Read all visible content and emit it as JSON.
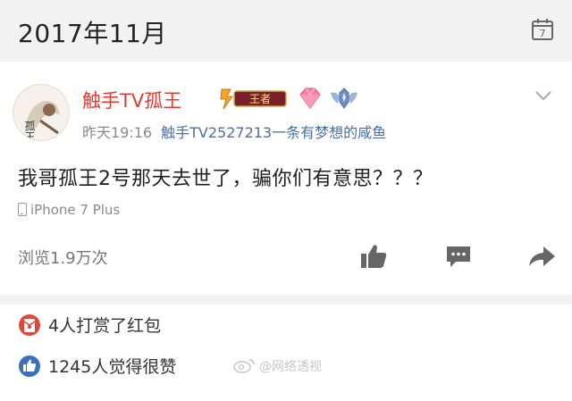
{
  "header": {
    "month": "2017年11月",
    "calendar_icon": "calendar-icon",
    "calendar_day": "7"
  },
  "post": {
    "author": "触手TV孤王",
    "avatar_text": "孤王",
    "badges": {
      "king_label": "王者",
      "king_icon": "king-rank-badge",
      "diamond_icon": "diamond-badge",
      "wing_icon": "wing-badge"
    },
    "time": "昨天19:16",
    "source": "触手TV2527213一条有梦想的咸鱼",
    "text": "我哥孤王2号那天去世了，骗你们有意思？？？",
    "device": "iPhone 7 Plus",
    "views": "浏览1.9万次",
    "actions": {
      "like_icon": "thumbs-up-icon",
      "comment_icon": "comment-icon",
      "share_icon": "share-arrow-icon"
    }
  },
  "stats": {
    "reward": "4人打赏了红包",
    "likes": "1245人觉得很赞"
  },
  "watermark": "@网络透视",
  "colors": {
    "author_red": "#e8372f",
    "link_blue": "#4a6fa5",
    "background_gray": "#f2f2f2",
    "like_blue": "#3b6fc1",
    "reward_red": "#e0483b"
  }
}
